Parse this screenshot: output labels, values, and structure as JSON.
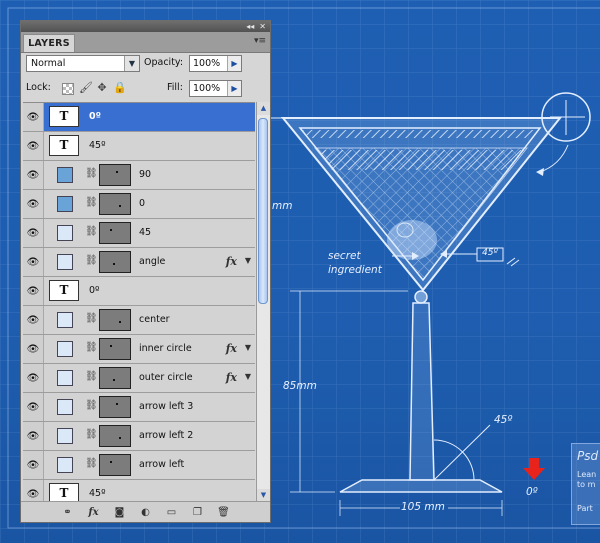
{
  "panel": {
    "tab_label": "LAYERS",
    "blend_mode": "Normal",
    "opacity_label": "Opacity:",
    "opacity_value": "100%",
    "lock_label": "Lock:",
    "fill_label": "Fill:",
    "fill_value": "100%"
  },
  "layers": [
    {
      "name": "0º",
      "kind": "type",
      "selected": true
    },
    {
      "name": "45º",
      "kind": "type"
    },
    {
      "name": "90",
      "kind": "shape",
      "color": "#6aa3d8"
    },
    {
      "name": "0",
      "kind": "shape",
      "color": "#6aa3d8"
    },
    {
      "name": "45",
      "kind": "shape",
      "color": "#dbe8f7"
    },
    {
      "name": "angle",
      "kind": "shape",
      "color": "#dbe8f7",
      "fx": true
    },
    {
      "name": "0º",
      "kind": "type"
    },
    {
      "name": "center",
      "kind": "shape",
      "color": "#dbe8f7"
    },
    {
      "name": "inner circle",
      "kind": "shape",
      "color": "#dbe8f7",
      "fx": true
    },
    {
      "name": "outer circle",
      "kind": "shape",
      "color": "#dbe8f7",
      "fx": true
    },
    {
      "name": "arrow left 3",
      "kind": "shape",
      "color": "#dbe8f7"
    },
    {
      "name": "arrow left 2",
      "kind": "shape",
      "color": "#dbe8f7"
    },
    {
      "name": "arrow left",
      "kind": "shape",
      "color": "#dbe8f7"
    },
    {
      "name": "45º",
      "kind": "type"
    }
  ],
  "type_thumb_glyph": "T",
  "blueprint": {
    "mm_partial": "mm",
    "secret": "secret",
    "ingredient": "ingredient",
    "angle_label": "45º",
    "height_label": "85mm",
    "base_angle": "45º",
    "width_label": "105 mm",
    "zero_label": "0º",
    "side_title": "Psd",
    "side_line1": "Lean",
    "side_line2": "to m",
    "side_part": "Part"
  },
  "colors": {
    "background": "#1f5fb0",
    "panel": "#d6d6d6",
    "selection": "#3a6fd2",
    "arrow_red": "#e8231c"
  }
}
